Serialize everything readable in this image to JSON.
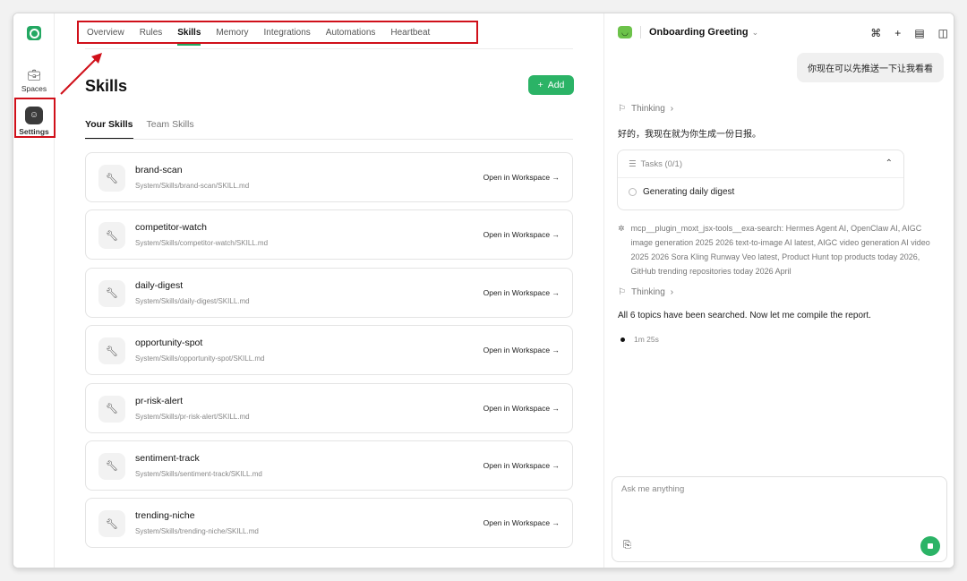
{
  "rail": {
    "spaces_label": "Spaces",
    "settings_label": "Settings"
  },
  "tabs": [
    "Overview",
    "Rules",
    "Skills",
    "Memory",
    "Integrations",
    "Automations",
    "Heartbeat"
  ],
  "active_tab": "Skills",
  "page": {
    "title": "Skills",
    "add_label": "Add",
    "subtabs": [
      "Your Skills",
      "Team Skills"
    ],
    "open_label": "Open in Workspace →"
  },
  "skills": [
    {
      "name": "brand-scan",
      "path": "System/Skills/brand-scan/SKILL.md"
    },
    {
      "name": "competitor-watch",
      "path": "System/Skills/competitor-watch/SKILL.md"
    },
    {
      "name": "daily-digest",
      "path": "System/Skills/daily-digest/SKILL.md"
    },
    {
      "name": "opportunity-spot",
      "path": "System/Skills/opportunity-spot/SKILL.md"
    },
    {
      "name": "pr-risk-alert",
      "path": "System/Skills/pr-risk-alert/SKILL.md"
    },
    {
      "name": "sentiment-track",
      "path": "System/Skills/sentiment-track/SKILL.md"
    },
    {
      "name": "trending-niche",
      "path": "System/Skills/trending-niche/SKILL.md"
    }
  ],
  "chat": {
    "title": "Onboarding Greeting",
    "user_message": "你现在可以先推送一下让我看看",
    "thinking_label": "Thinking",
    "reply_1": "好的，我现在就为你生成一份日报。",
    "tasks_label": "Tasks (0/1)",
    "task_item": "Generating daily digest",
    "tool_call": "mcp__plugin_moxt_jsx-tools__exa-search:  Hermes Agent AI, OpenClaw AI, AIGC image generation 2025 2026 text-to-image AI latest, AIGC video generation AI video 2025 2026 Sora Kling Runway Veo latest, Product Hunt top products today 2026, GitHub trending repositories today 2026 April",
    "reply_2": "All 6 topics have been searched. Now let me compile the report.",
    "elapsed": "1m 25s",
    "input_placeholder": "Ask me anything"
  },
  "colors": {
    "accent": "#2bb366",
    "highlight_box": "#d0101a"
  }
}
